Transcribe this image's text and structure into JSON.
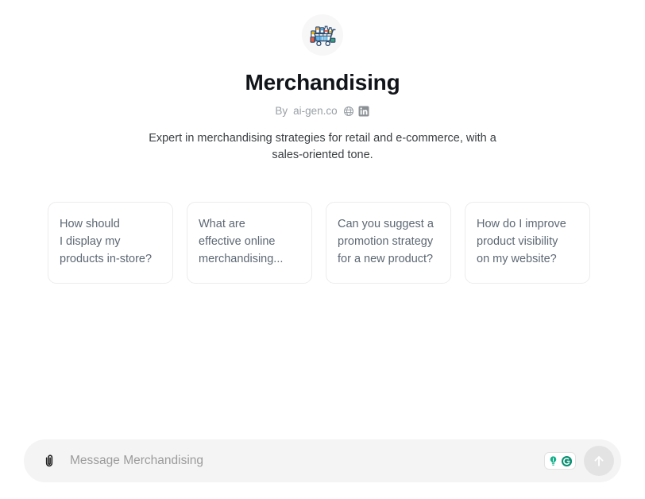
{
  "agent": {
    "name": "Merchandising",
    "avatar_icon": "shopping-cart-groceries-icon",
    "by_label": "By",
    "author": "ai-gen.co",
    "description": "Expert in merchandising strategies for retail and e-commerce, with a sales-oriented tone.",
    "social": [
      {
        "icon": "globe-icon",
        "name": "website-link"
      },
      {
        "icon": "linkedin-icon",
        "name": "linkedin-link"
      }
    ]
  },
  "suggestions": [
    {
      "text": "How should\nI display my\nproducts in-store?"
    },
    {
      "text": "What are\neffective online\nmerchandising..."
    },
    {
      "text": "Can you suggest a\npromotion strategy\nfor a new product?"
    },
    {
      "text": "How do I improve\nproduct visibility\non my website?"
    }
  ],
  "composer": {
    "attach_icon": "paperclip-icon",
    "placeholder": "Message Merchandising",
    "value": "",
    "assist_badge_icons": [
      "lightbulb-icon",
      "grammarly-g-icon"
    ],
    "send_icon": "arrow-up-icon"
  },
  "colors": {
    "accent": "#14b08a",
    "title": "#111418",
    "muted": "#9aa0a6",
    "card_text": "#5d6874",
    "composer_bg": "#f4f4f4",
    "send_bg": "#e3e3e3"
  }
}
